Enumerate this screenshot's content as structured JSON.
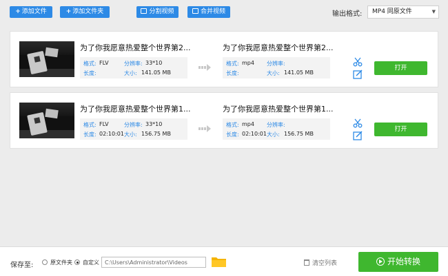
{
  "toolbar": {
    "add_file": "添加文件",
    "add_folder": "添加文件夹",
    "split_video": "分割视频",
    "merge_video": "合并视频",
    "output_format_label": "输出格式:",
    "output_format_value": "MP4  同原文件"
  },
  "files": [
    {
      "title_in": "为了你我愿意热爱整个世界第2...",
      "title_out": "为了你我愿意热爱整个世界第2...",
      "format_label": "格式:",
      "resolution_label": "分辨率:",
      "duration_label": "长度:",
      "size_label": "大小:",
      "in_format": "FLV",
      "in_resolution": "33*10",
      "in_duration": "",
      "in_size": "141.05 MB",
      "out_format": "mp4",
      "out_resolution": "",
      "out_duration": "",
      "out_size": "141.05 MB",
      "open_label": "打开"
    },
    {
      "title_in": "为了你我愿意热爱整个世界第1...",
      "title_out": "为了你我愿意热爱整个世界第1...",
      "format_label": "格式:",
      "resolution_label": "分辨率:",
      "duration_label": "长度:",
      "size_label": "大小:",
      "in_format": "FLV",
      "in_resolution": "33*10",
      "in_duration": "02:10:01",
      "in_size": "156.75 MB",
      "out_format": "mp4",
      "out_resolution": "",
      "out_duration": "02:10:01",
      "out_size": "156.75 MB",
      "open_label": "打开"
    }
  ],
  "bottom": {
    "save_to_label": "保存至:",
    "option_original": "原文件夹",
    "option_custom": "自定义",
    "path_value": "C:\\Users\\Administrator\\Videos",
    "clear_list": "清空列表",
    "start_convert": "开始转换"
  },
  "colors": {
    "accent_blue": "#2d8ae6",
    "accent_green": "#3fb72f"
  },
  "icons": [
    "plus-icon",
    "split-icon",
    "merge-icon",
    "dropdown-arrow-icon",
    "scissors-icon",
    "edit-icon",
    "arrow-right-icon",
    "folder-icon",
    "trash-icon",
    "play-icon"
  ]
}
